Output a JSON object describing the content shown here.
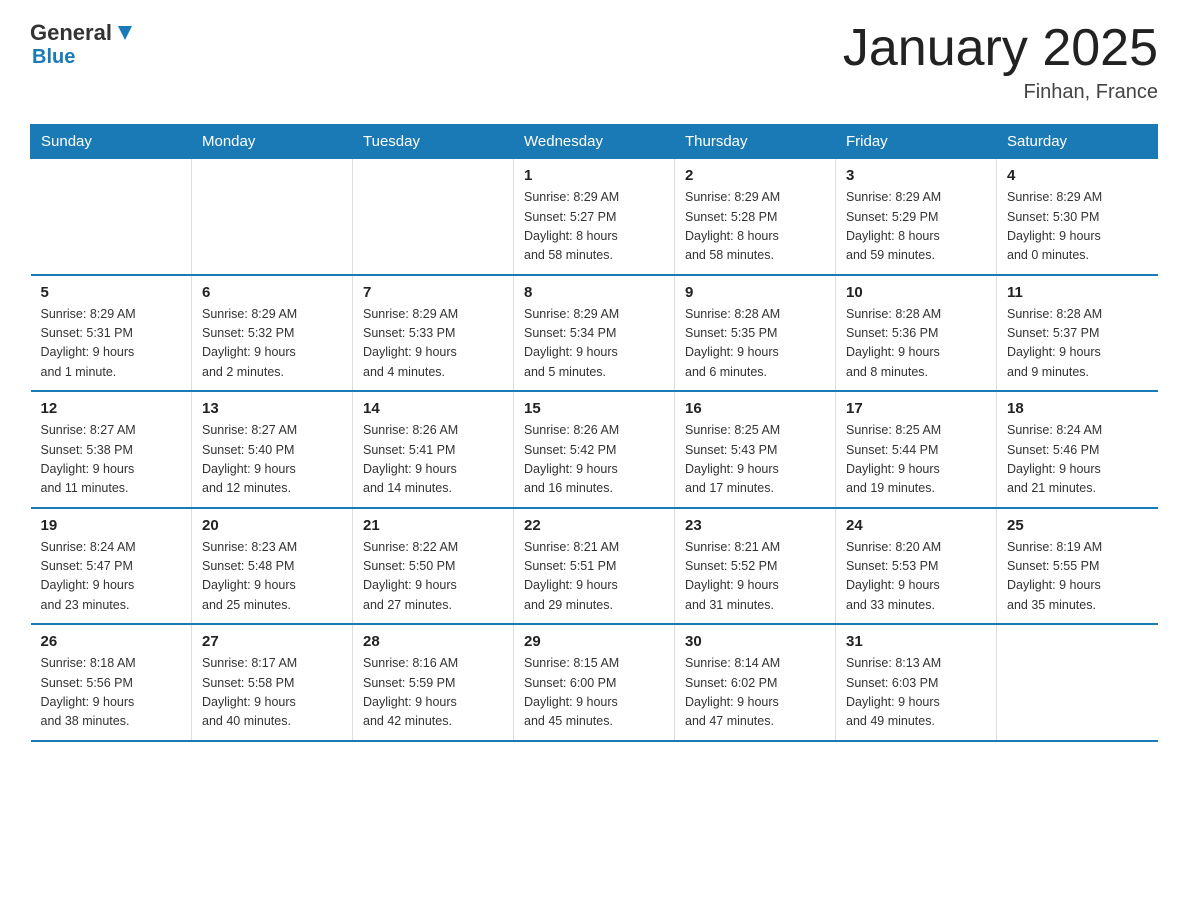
{
  "header": {
    "logo_general": "General",
    "logo_blue": "Blue",
    "title": "January 2025",
    "subtitle": "Finhan, France"
  },
  "days_of_week": [
    "Sunday",
    "Monday",
    "Tuesday",
    "Wednesday",
    "Thursday",
    "Friday",
    "Saturday"
  ],
  "weeks": [
    [
      {
        "day": "",
        "info": ""
      },
      {
        "day": "",
        "info": ""
      },
      {
        "day": "",
        "info": ""
      },
      {
        "day": "1",
        "info": "Sunrise: 8:29 AM\nSunset: 5:27 PM\nDaylight: 8 hours\nand 58 minutes."
      },
      {
        "day": "2",
        "info": "Sunrise: 8:29 AM\nSunset: 5:28 PM\nDaylight: 8 hours\nand 58 minutes."
      },
      {
        "day": "3",
        "info": "Sunrise: 8:29 AM\nSunset: 5:29 PM\nDaylight: 8 hours\nand 59 minutes."
      },
      {
        "day": "4",
        "info": "Sunrise: 8:29 AM\nSunset: 5:30 PM\nDaylight: 9 hours\nand 0 minutes."
      }
    ],
    [
      {
        "day": "5",
        "info": "Sunrise: 8:29 AM\nSunset: 5:31 PM\nDaylight: 9 hours\nand 1 minute."
      },
      {
        "day": "6",
        "info": "Sunrise: 8:29 AM\nSunset: 5:32 PM\nDaylight: 9 hours\nand 2 minutes."
      },
      {
        "day": "7",
        "info": "Sunrise: 8:29 AM\nSunset: 5:33 PM\nDaylight: 9 hours\nand 4 minutes."
      },
      {
        "day": "8",
        "info": "Sunrise: 8:29 AM\nSunset: 5:34 PM\nDaylight: 9 hours\nand 5 minutes."
      },
      {
        "day": "9",
        "info": "Sunrise: 8:28 AM\nSunset: 5:35 PM\nDaylight: 9 hours\nand 6 minutes."
      },
      {
        "day": "10",
        "info": "Sunrise: 8:28 AM\nSunset: 5:36 PM\nDaylight: 9 hours\nand 8 minutes."
      },
      {
        "day": "11",
        "info": "Sunrise: 8:28 AM\nSunset: 5:37 PM\nDaylight: 9 hours\nand 9 minutes."
      }
    ],
    [
      {
        "day": "12",
        "info": "Sunrise: 8:27 AM\nSunset: 5:38 PM\nDaylight: 9 hours\nand 11 minutes."
      },
      {
        "day": "13",
        "info": "Sunrise: 8:27 AM\nSunset: 5:40 PM\nDaylight: 9 hours\nand 12 minutes."
      },
      {
        "day": "14",
        "info": "Sunrise: 8:26 AM\nSunset: 5:41 PM\nDaylight: 9 hours\nand 14 minutes."
      },
      {
        "day": "15",
        "info": "Sunrise: 8:26 AM\nSunset: 5:42 PM\nDaylight: 9 hours\nand 16 minutes."
      },
      {
        "day": "16",
        "info": "Sunrise: 8:25 AM\nSunset: 5:43 PM\nDaylight: 9 hours\nand 17 minutes."
      },
      {
        "day": "17",
        "info": "Sunrise: 8:25 AM\nSunset: 5:44 PM\nDaylight: 9 hours\nand 19 minutes."
      },
      {
        "day": "18",
        "info": "Sunrise: 8:24 AM\nSunset: 5:46 PM\nDaylight: 9 hours\nand 21 minutes."
      }
    ],
    [
      {
        "day": "19",
        "info": "Sunrise: 8:24 AM\nSunset: 5:47 PM\nDaylight: 9 hours\nand 23 minutes."
      },
      {
        "day": "20",
        "info": "Sunrise: 8:23 AM\nSunset: 5:48 PM\nDaylight: 9 hours\nand 25 minutes."
      },
      {
        "day": "21",
        "info": "Sunrise: 8:22 AM\nSunset: 5:50 PM\nDaylight: 9 hours\nand 27 minutes."
      },
      {
        "day": "22",
        "info": "Sunrise: 8:21 AM\nSunset: 5:51 PM\nDaylight: 9 hours\nand 29 minutes."
      },
      {
        "day": "23",
        "info": "Sunrise: 8:21 AM\nSunset: 5:52 PM\nDaylight: 9 hours\nand 31 minutes."
      },
      {
        "day": "24",
        "info": "Sunrise: 8:20 AM\nSunset: 5:53 PM\nDaylight: 9 hours\nand 33 minutes."
      },
      {
        "day": "25",
        "info": "Sunrise: 8:19 AM\nSunset: 5:55 PM\nDaylight: 9 hours\nand 35 minutes."
      }
    ],
    [
      {
        "day": "26",
        "info": "Sunrise: 8:18 AM\nSunset: 5:56 PM\nDaylight: 9 hours\nand 38 minutes."
      },
      {
        "day": "27",
        "info": "Sunrise: 8:17 AM\nSunset: 5:58 PM\nDaylight: 9 hours\nand 40 minutes."
      },
      {
        "day": "28",
        "info": "Sunrise: 8:16 AM\nSunset: 5:59 PM\nDaylight: 9 hours\nand 42 minutes."
      },
      {
        "day": "29",
        "info": "Sunrise: 8:15 AM\nSunset: 6:00 PM\nDaylight: 9 hours\nand 45 minutes."
      },
      {
        "day": "30",
        "info": "Sunrise: 8:14 AM\nSunset: 6:02 PM\nDaylight: 9 hours\nand 47 minutes."
      },
      {
        "day": "31",
        "info": "Sunrise: 8:13 AM\nSunset: 6:03 PM\nDaylight: 9 hours\nand 49 minutes."
      },
      {
        "day": "",
        "info": ""
      }
    ]
  ]
}
